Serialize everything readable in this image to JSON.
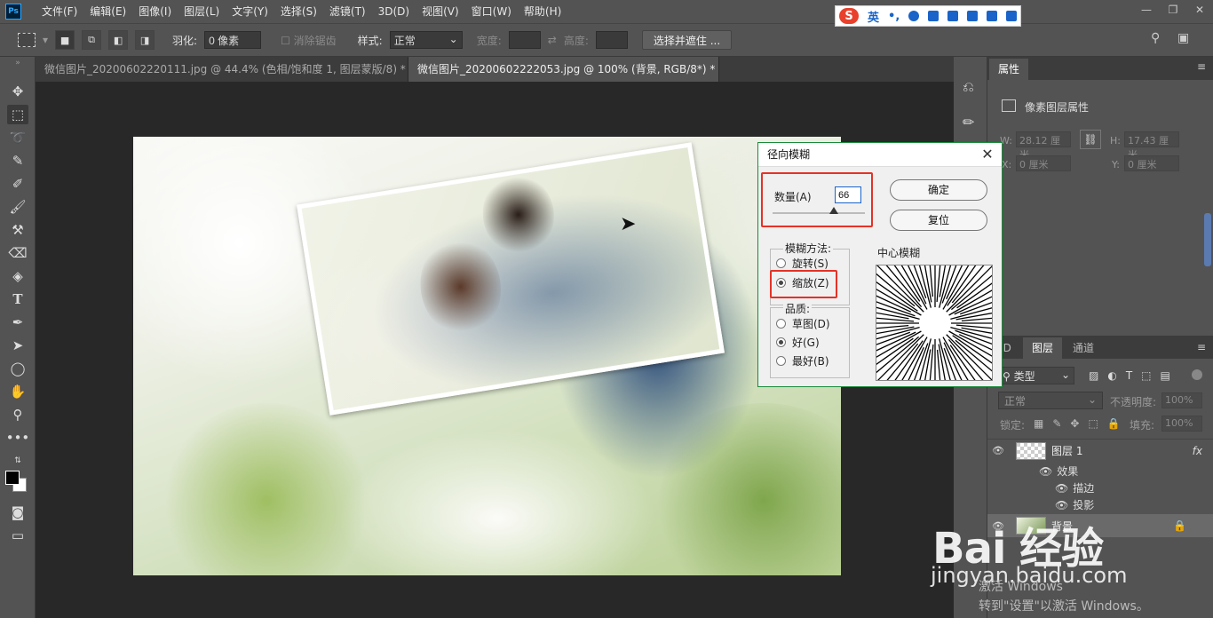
{
  "app": {
    "logo": "Ps"
  },
  "menu": [
    "文件(F)",
    "编辑(E)",
    "图像(I)",
    "图层(L)",
    "文字(Y)",
    "选择(S)",
    "滤镜(T)",
    "3D(D)",
    "视图(V)",
    "窗口(W)",
    "帮助(H)"
  ],
  "ime": {
    "lang": "英"
  },
  "options": {
    "feather_label": "羽化:",
    "feather_value": "0 像素",
    "antialias_label": "消除锯齿",
    "style_label": "样式:",
    "style_value": "正常",
    "width_label": "宽度:",
    "height_label": "高度:",
    "select_mask_button": "选择并遮住 ..."
  },
  "tabs": [
    {
      "label": "微信图片_20200602220111.jpg @ 44.4% (色相/饱和度 1, 图层蒙版/8) *",
      "close": "×"
    },
    {
      "label": "微信图片_20200602222053.jpg @ 100% (背景, RGB/8*) *",
      "close": "×"
    }
  ],
  "dialog": {
    "title": "径向模糊",
    "close": "✕",
    "amount_label": "数量(A)",
    "amount_value": "66",
    "amount_fraction": 0.66,
    "ok_button": "确定",
    "reset_button": "复位",
    "method_label": "模糊方法:",
    "method_spin": "旋转(S)",
    "method_zoom": "缩放(Z)",
    "quality_label": "品质:",
    "quality_draft": "草图(D)",
    "quality_good": "好(G)",
    "quality_best": "最好(B)",
    "center_label": "中心模糊",
    "selected_method": "缩放(Z)",
    "selected_quality": "好(G)"
  },
  "properties": {
    "tab": "属性",
    "header": "像素图层属性",
    "w_label": "W:",
    "w_value": "28.12 厘米",
    "h_label": "H:",
    "h_value": "17.43 厘米",
    "x_label": "X:",
    "x_value": "0 厘米",
    "y_label": "Y:",
    "y_value": "0 厘米"
  },
  "layers_panel": {
    "tabs": [
      "3D",
      "图层",
      "通道"
    ],
    "filter_label": "类型",
    "blend_mode": "正常",
    "opacity_label": "不透明度:",
    "opacity_value": "100%",
    "lock_label": "锁定:",
    "fill_label": "填充:",
    "fill_value": "100%",
    "layers": [
      {
        "name": "图层 1",
        "fx": "fx",
        "effects_label": "效果",
        "effects": [
          "描边",
          "投影"
        ]
      },
      {
        "name": "背景"
      }
    ]
  },
  "watermark": {
    "brand": "Bai 经验",
    "url": "jingyan.baidu.com"
  },
  "activation": {
    "line1": "激活 Windows",
    "line2": "转到\"设置\"以激活 Windows。"
  },
  "colors": {
    "accent_red": "#e53226",
    "ps_dark": "#535353",
    "dialog_border": "#1b8a3a"
  }
}
